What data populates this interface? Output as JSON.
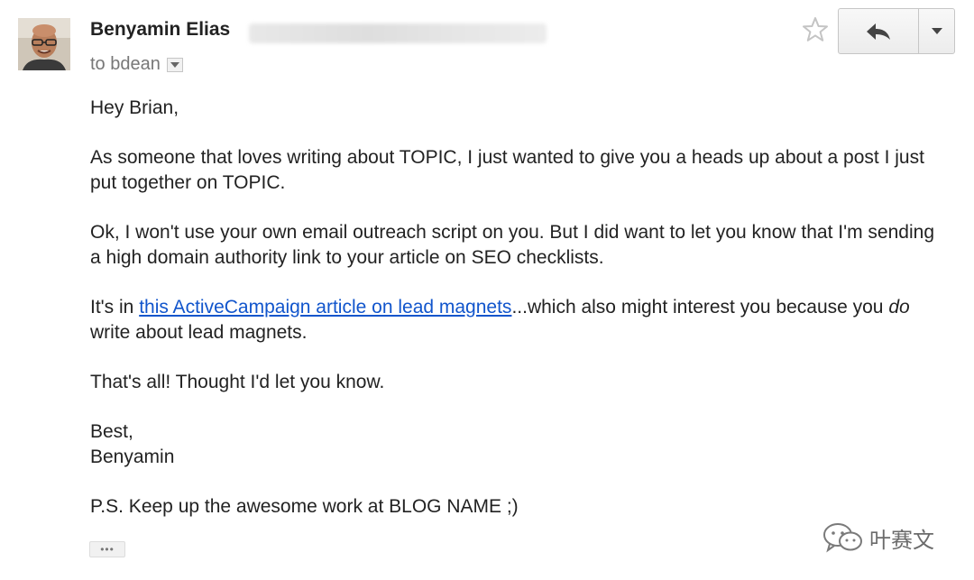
{
  "header": {
    "sender_name": "Benyamin Elias",
    "recipient_prefix": "to bdean",
    "star_icon": "star-icon",
    "reply_icon": "reply-icon",
    "more_icon": "chevron-down-icon"
  },
  "email_body": {
    "greeting": "Hey Brian,",
    "paragraph1": "As someone that loves writing about TOPIC, I just wanted to give you a heads up about a post I just put together on TOPIC.",
    "paragraph2": "Ok, I won't use your own email outreach script on you. But I did want to let you know that I'm sending a high domain authority link to your article on SEO checklists.",
    "paragraph3_prefix": "It's in ",
    "paragraph3_link": "this ActiveCampaign article on lead magnets",
    "paragraph3_mid": "...which also might interest you because you ",
    "paragraph3_em": "do",
    "paragraph3_suffix": " write about lead magnets.",
    "paragraph4": "That's all! Thought I'd let you know.",
    "signoff": "Best,",
    "signature": "Benyamin",
    "postscript": "P.S. Keep up the awesome work at BLOG NAME ;)"
  },
  "trimmed_content_label": "•••",
  "watermark": {
    "text": "叶赛文",
    "icon": "wechat-icon"
  },
  "colors": {
    "link": "#1155cc",
    "text": "#222222",
    "muted": "#777777"
  }
}
